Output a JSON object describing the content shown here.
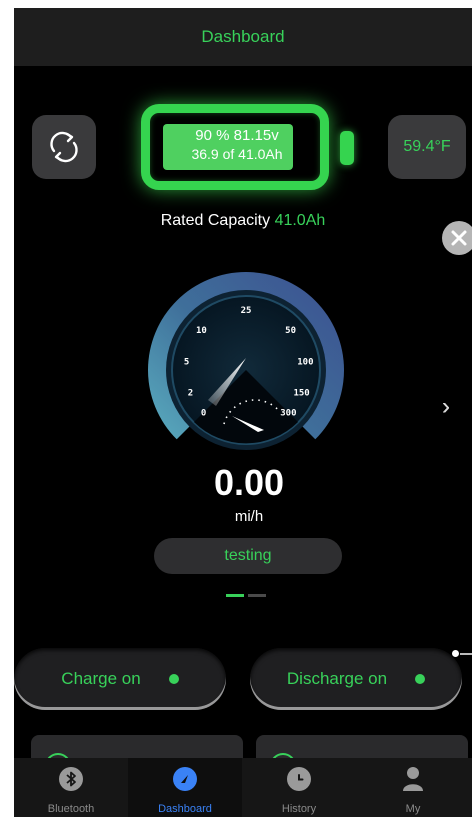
{
  "header": {
    "title": "Dashboard"
  },
  "battery": {
    "line1": "90 % 81.15v",
    "line2": "36.9 of 41.0Ah",
    "charge_fraction": 0.9
  },
  "temperature": {
    "value": "59.4°F"
  },
  "rated_capacity": {
    "label": "Rated Capacity",
    "value": "41.0Ah"
  },
  "gauge": {
    "tick_labels": [
      "0",
      "2",
      "5",
      "10",
      "25",
      "50",
      "100",
      "150",
      "300"
    ],
    "needle_value": "0"
  },
  "speed": {
    "value": "0.00",
    "unit": "mi/h"
  },
  "status": {
    "text": "testing"
  },
  "pager": {
    "pages": 2,
    "active": 0
  },
  "toggles": {
    "charge": {
      "label": "Charge on",
      "state": "on"
    },
    "discharge": {
      "label": "Discharge on",
      "state": "on"
    }
  },
  "tabs": [
    {
      "label": "Bluetooth",
      "icon": "bluetooth-icon",
      "active": false
    },
    {
      "label": "Dashboard",
      "icon": "dashboard-icon",
      "active": true
    },
    {
      "label": "History",
      "icon": "history-clock-icon",
      "active": false
    },
    {
      "label": "My",
      "icon": "person-icon",
      "active": false
    }
  ],
  "colors": {
    "accent_green": "#38d15a",
    "active_tab_blue": "#3a82f6",
    "background": "#000000"
  }
}
